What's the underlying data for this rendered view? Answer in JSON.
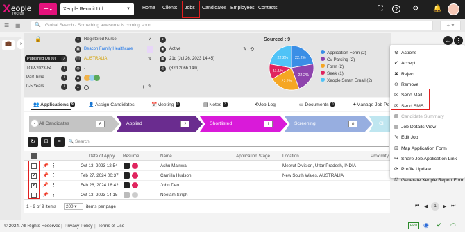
{
  "topbar": {
    "logo_x": "X",
    "logo_word": "eople",
    "logo_sub": "recruit",
    "plus": "+",
    "company": "Xeople Recruit Ltd",
    "nav": [
      "Home",
      "Clients",
      "Jobs",
      "Candidates",
      "Employees",
      "Contacts"
    ],
    "help": "?"
  },
  "search": {
    "placeholder": "Global Search - Something awesome is coming soon"
  },
  "job_summary": {
    "published": "Published On (0)",
    "ref": "TOP-2023-84",
    "type": "Part Time",
    "experience": "0-5 Years",
    "role": "Registered Nurse",
    "client": "Beacon Family Healthcare",
    "location": "AUSTRALIA",
    "status": "Active",
    "date1": "21d (Jul 26, 2023 14:45)",
    "date2": "(82d 206h 14m)",
    "dash": "-"
  },
  "sourced": {
    "title": "Sourced : 9",
    "legend": [
      "Application Form (2)",
      "Cv Parsing (2)",
      "Form (2)",
      "Seek (1)",
      "Xeople Smart Email (2)"
    ],
    "slices": [
      {
        "label": "22.2%",
        "value": 22.2,
        "color": "#3a8ee6"
      },
      {
        "label": "22.2%",
        "value": 22.2,
        "color": "#8e44ad"
      },
      {
        "label": "22.2%",
        "value": 22.2,
        "color": "#f5a623"
      },
      {
        "label": "11.1%",
        "value": 11.1,
        "color": "#e0245e"
      },
      {
        "label": "22.2%",
        "value": 22.2,
        "color": "#4fc3f7"
      }
    ]
  },
  "tabs": [
    {
      "label": "Applications",
      "count": "9"
    },
    {
      "label": "Assign Candidates",
      "count": ""
    },
    {
      "label": "Meeting",
      "count": "0"
    },
    {
      "label": "Notes",
      "count": "3"
    },
    {
      "label": "Job Log",
      "count": ""
    },
    {
      "label": "Documents",
      "count": "0"
    },
    {
      "label": "Manage Job Po",
      "count": ""
    }
  ],
  "pipeline": [
    {
      "label": "All Candidates",
      "count": "6"
    },
    {
      "label": "Applied",
      "count": "2"
    },
    {
      "label": "Shortlisted",
      "count": "1"
    },
    {
      "label": "Screening",
      "count": "0"
    },
    {
      "label": "Cli",
      "count": ""
    }
  ],
  "grid": {
    "search_placeholder": "Search",
    "headers": [
      "Date of Apply",
      "Resume",
      "Name",
      "Application Stage",
      "Location",
      "Proximity"
    ],
    "rows": [
      {
        "date": "Oct 13, 2023 12:54",
        "name": "Ashu Mainwal",
        "stage": "",
        "location": "Meerut Division, Uttar Pradesh, INDIA",
        "checked": false
      },
      {
        "date": "Feb 27, 2024 00:37",
        "name": "Camilla Hudson",
        "stage": "",
        "location": "New South Wales, AUSTRALIA",
        "checked": true
      },
      {
        "date": "Feb 26, 2024 18:42",
        "name": "John Deo",
        "stage": "",
        "location": "",
        "checked": true
      },
      {
        "date": "Oct 13, 2023 14:15",
        "name": "Neelam Singh",
        "stage": "",
        "location": "",
        "checked": false
      }
    ],
    "pagination": "1 - 9 of 9 items",
    "page_size": "200",
    "per_page": "items per page",
    "page": "1"
  },
  "menu": {
    "items": [
      "Actions",
      "Accept",
      "Reject",
      "Remove",
      "Send Mail",
      "Send SMS",
      "Candidate Summary",
      "Job Details View",
      "Edit Job",
      "Map Application Form",
      "Share Job Application Link",
      "Profile Update",
      "Generate Xeople Report Form"
    ]
  },
  "footer": {
    "copyright": "© 2024. All Rights Reserved",
    "privacy": "Privacy Policy",
    "terms": "Terms of Use",
    "ppd": "PPD"
  }
}
